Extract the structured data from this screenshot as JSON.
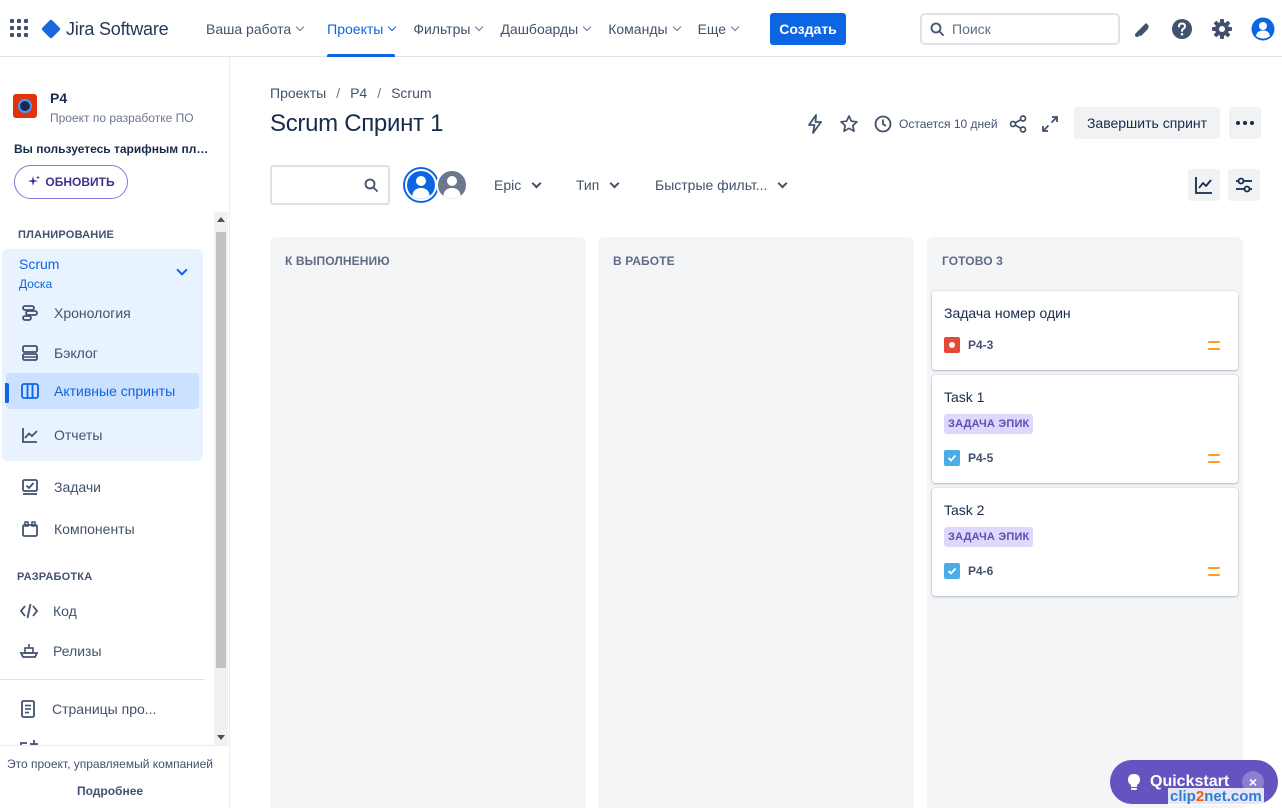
{
  "topnav": {
    "product": "Jira Software",
    "items": [
      {
        "label": "Ваша работа",
        "active": false
      },
      {
        "label": "Проекты",
        "active": true
      },
      {
        "label": "Фильтры",
        "active": false
      },
      {
        "label": "Дашбоарды",
        "active": false
      },
      {
        "label": "Команды",
        "active": false
      },
      {
        "label": "Еще",
        "active": false
      }
    ],
    "create_label": "Создать",
    "search_placeholder": "Поиск",
    "icons": [
      "notification-icon",
      "help-icon",
      "settings-icon",
      "profile-icon"
    ]
  },
  "sidebar": {
    "project_name": "P4",
    "project_type": "Проект по разработке ПО",
    "plan_note": "Вы пользуетесь тарифным план...",
    "upgrade_label": "ОБНОВИТЬ",
    "planning_title": "ПЛАНИРОВАНИЕ",
    "scrum": {
      "title": "Scrum",
      "subtitle": "Доска"
    },
    "planning_items": [
      {
        "label": "Хронология",
        "icon": "timeline-icon"
      },
      {
        "label": "Бэклог",
        "icon": "backlog-icon"
      },
      {
        "label": "Активные спринты",
        "icon": "board-icon",
        "selected": true
      },
      {
        "label": "Отчеты",
        "icon": "reports-icon"
      }
    ],
    "other_items": [
      {
        "label": "Задачи",
        "icon": "issues-icon"
      },
      {
        "label": "Компоненты",
        "icon": "components-icon"
      }
    ],
    "dev_title": "РАЗРАБОТКА",
    "dev_items": [
      {
        "label": "Код",
        "icon": "code-icon"
      },
      {
        "label": "Релизы",
        "icon": "releases-icon"
      }
    ],
    "pages_item": "Страницы про...",
    "footer_note": "Это проект, управляемый компанией",
    "footer_more": "Подробнее"
  },
  "main": {
    "breadcrumbs": [
      "Проекты",
      "P4",
      "Scrum"
    ],
    "title": "Scrum Спринт 1",
    "remaining": "Остается 10 дней",
    "complete_label": "Завершить спринт",
    "filters": [
      "Epic",
      "Тип",
      "Быстрые фильт..."
    ]
  },
  "columns": [
    {
      "title": "К ВЫПОЛНЕНИЮ",
      "cards": []
    },
    {
      "title": "В РАБОТЕ",
      "cards": []
    },
    {
      "title": "ГОТОВО 3",
      "cards": [
        {
          "title": "Задача номер один",
          "key": "P4-3",
          "type": "bug",
          "epic": null
        },
        {
          "title": "Task 1",
          "key": "P4-5",
          "type": "task",
          "epic": "ЗАДАЧА ЭПИК"
        },
        {
          "title": "Task 2",
          "key": "P4-6",
          "type": "task",
          "epic": "ЗАДАЧА ЭПИК"
        }
      ]
    }
  ],
  "quickstart": {
    "label": "Quickstart",
    "close": "×"
  },
  "watermark": {
    "pre": "clip",
    "mid": "2",
    "post": "net.com"
  },
  "colors": {
    "accent": "#0c66e4",
    "bug": "#e5493a",
    "task": "#4bade8",
    "epic_bg": "#dfd8fd",
    "priority": "#ff991f",
    "quickstart": "#6554c0"
  }
}
